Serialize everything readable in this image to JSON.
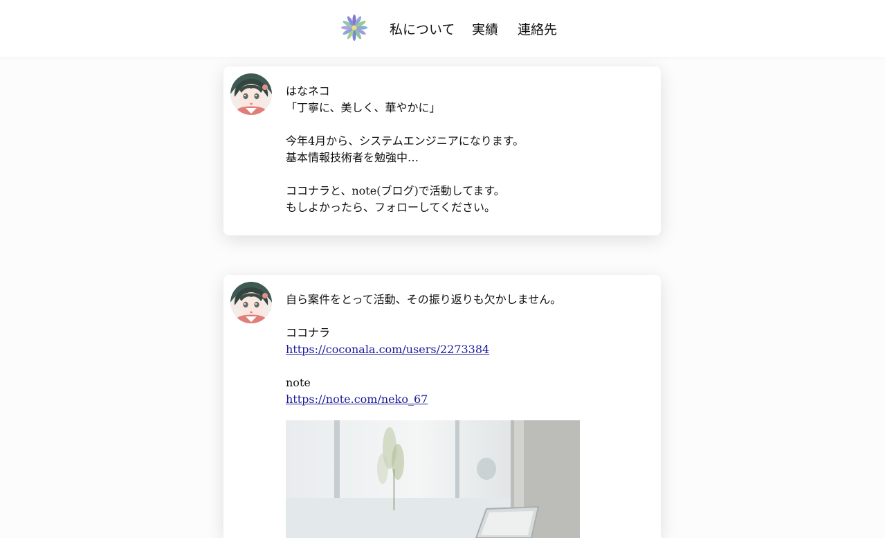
{
  "header": {
    "logo_icon": "flower-logo-icon",
    "nav": [
      {
        "label": "私について"
      },
      {
        "label": "実績"
      },
      {
        "label": "連絡先"
      }
    ]
  },
  "posts": [
    {
      "avatar_icon": "anime-girl-avatar",
      "lines": [
        "はなネコ",
        "「丁寧に、美しく、華やかに」",
        "",
        "今年4月から、システムエンジニアになります。",
        "基本情報技術者を勉強中…",
        "",
        "ココナラと、note(ブログ)で活動してます。",
        "もしよかったら、フォローしてください。"
      ]
    },
    {
      "avatar_icon": "anime-girl-avatar",
      "intro": "自ら案件をとって活動、その振り返りも欠かしません。",
      "coconala_label": "ココナラ",
      "coconala_url": "https://coconala.com/users/2273384",
      "note_label": "note",
      "note_url": "https://note.com/neko_67",
      "photo": "office-laptop-photo"
    }
  ],
  "colors": {
    "link": "#1a1a9a",
    "background": "#fcfcfc",
    "card": "#ffffff"
  }
}
